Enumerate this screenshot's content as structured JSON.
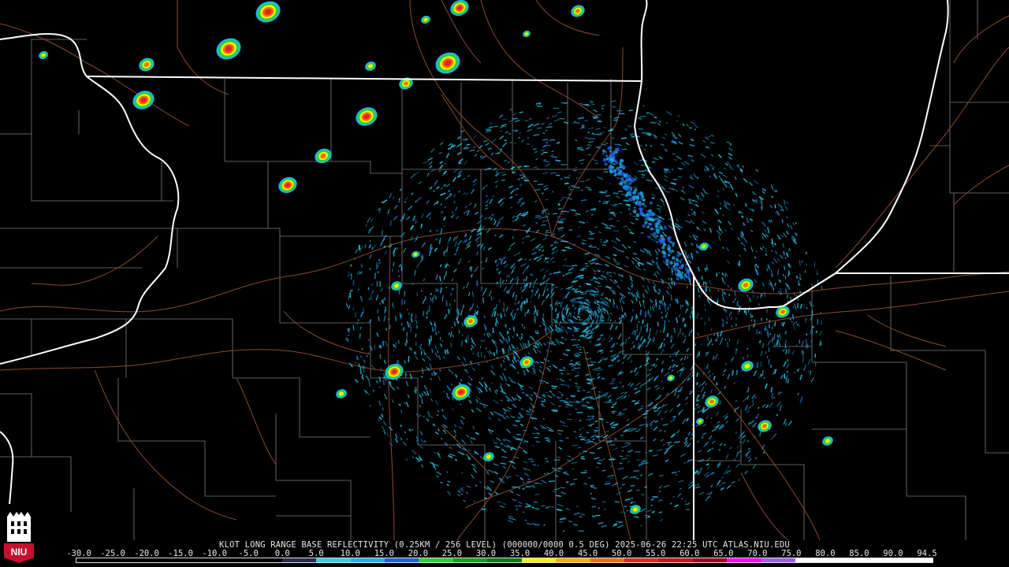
{
  "caption": "KLOT LONG RANGE BASE REFLECTIVITY (0.25KM / 256 LEVEL) (000000/0000 0.5 DEG) 2025-06-26 22:25 UTC  ATLAS.NIU.EDU",
  "scale": {
    "ticks": [
      "-30.0",
      "-25.0",
      "-20.0",
      "-15.0",
      "-10.0",
      "-5.0",
      "0.0",
      "5.0",
      "10.0",
      "15.0",
      "20.0",
      "25.0",
      "30.0",
      "35.0",
      "40.0",
      "45.0",
      "50.0",
      "55.0",
      "60.0",
      "65.0",
      "70.0",
      "75.0",
      "80.0",
      "85.0",
      "90.0",
      "94.5"
    ],
    "colors": [
      "#000000",
      "#000000",
      "#000000",
      "#000000",
      "#000000",
      "#000000",
      "#2a2a55",
      "#2fd0e0",
      "#1bb4e6",
      "#2060e0",
      "#21d53a",
      "#10a020",
      "#0c7a14",
      "#f7f000",
      "#f0b000",
      "#f07000",
      "#f02020",
      "#c8141e",
      "#a00020",
      "#ff00ff",
      "#a060e0",
      "#ffffff",
      "#ffffff",
      "#ffffff",
      "#ffffff"
    ]
  },
  "logo": {
    "text": "NIU",
    "color": "#c8102e"
  },
  "map": {
    "background": "#000000",
    "state_border_color": "#ffffff",
    "county_border_color": "#8a8a8a",
    "road_color": "#8b4a2b",
    "radar_site": "KLOT"
  }
}
